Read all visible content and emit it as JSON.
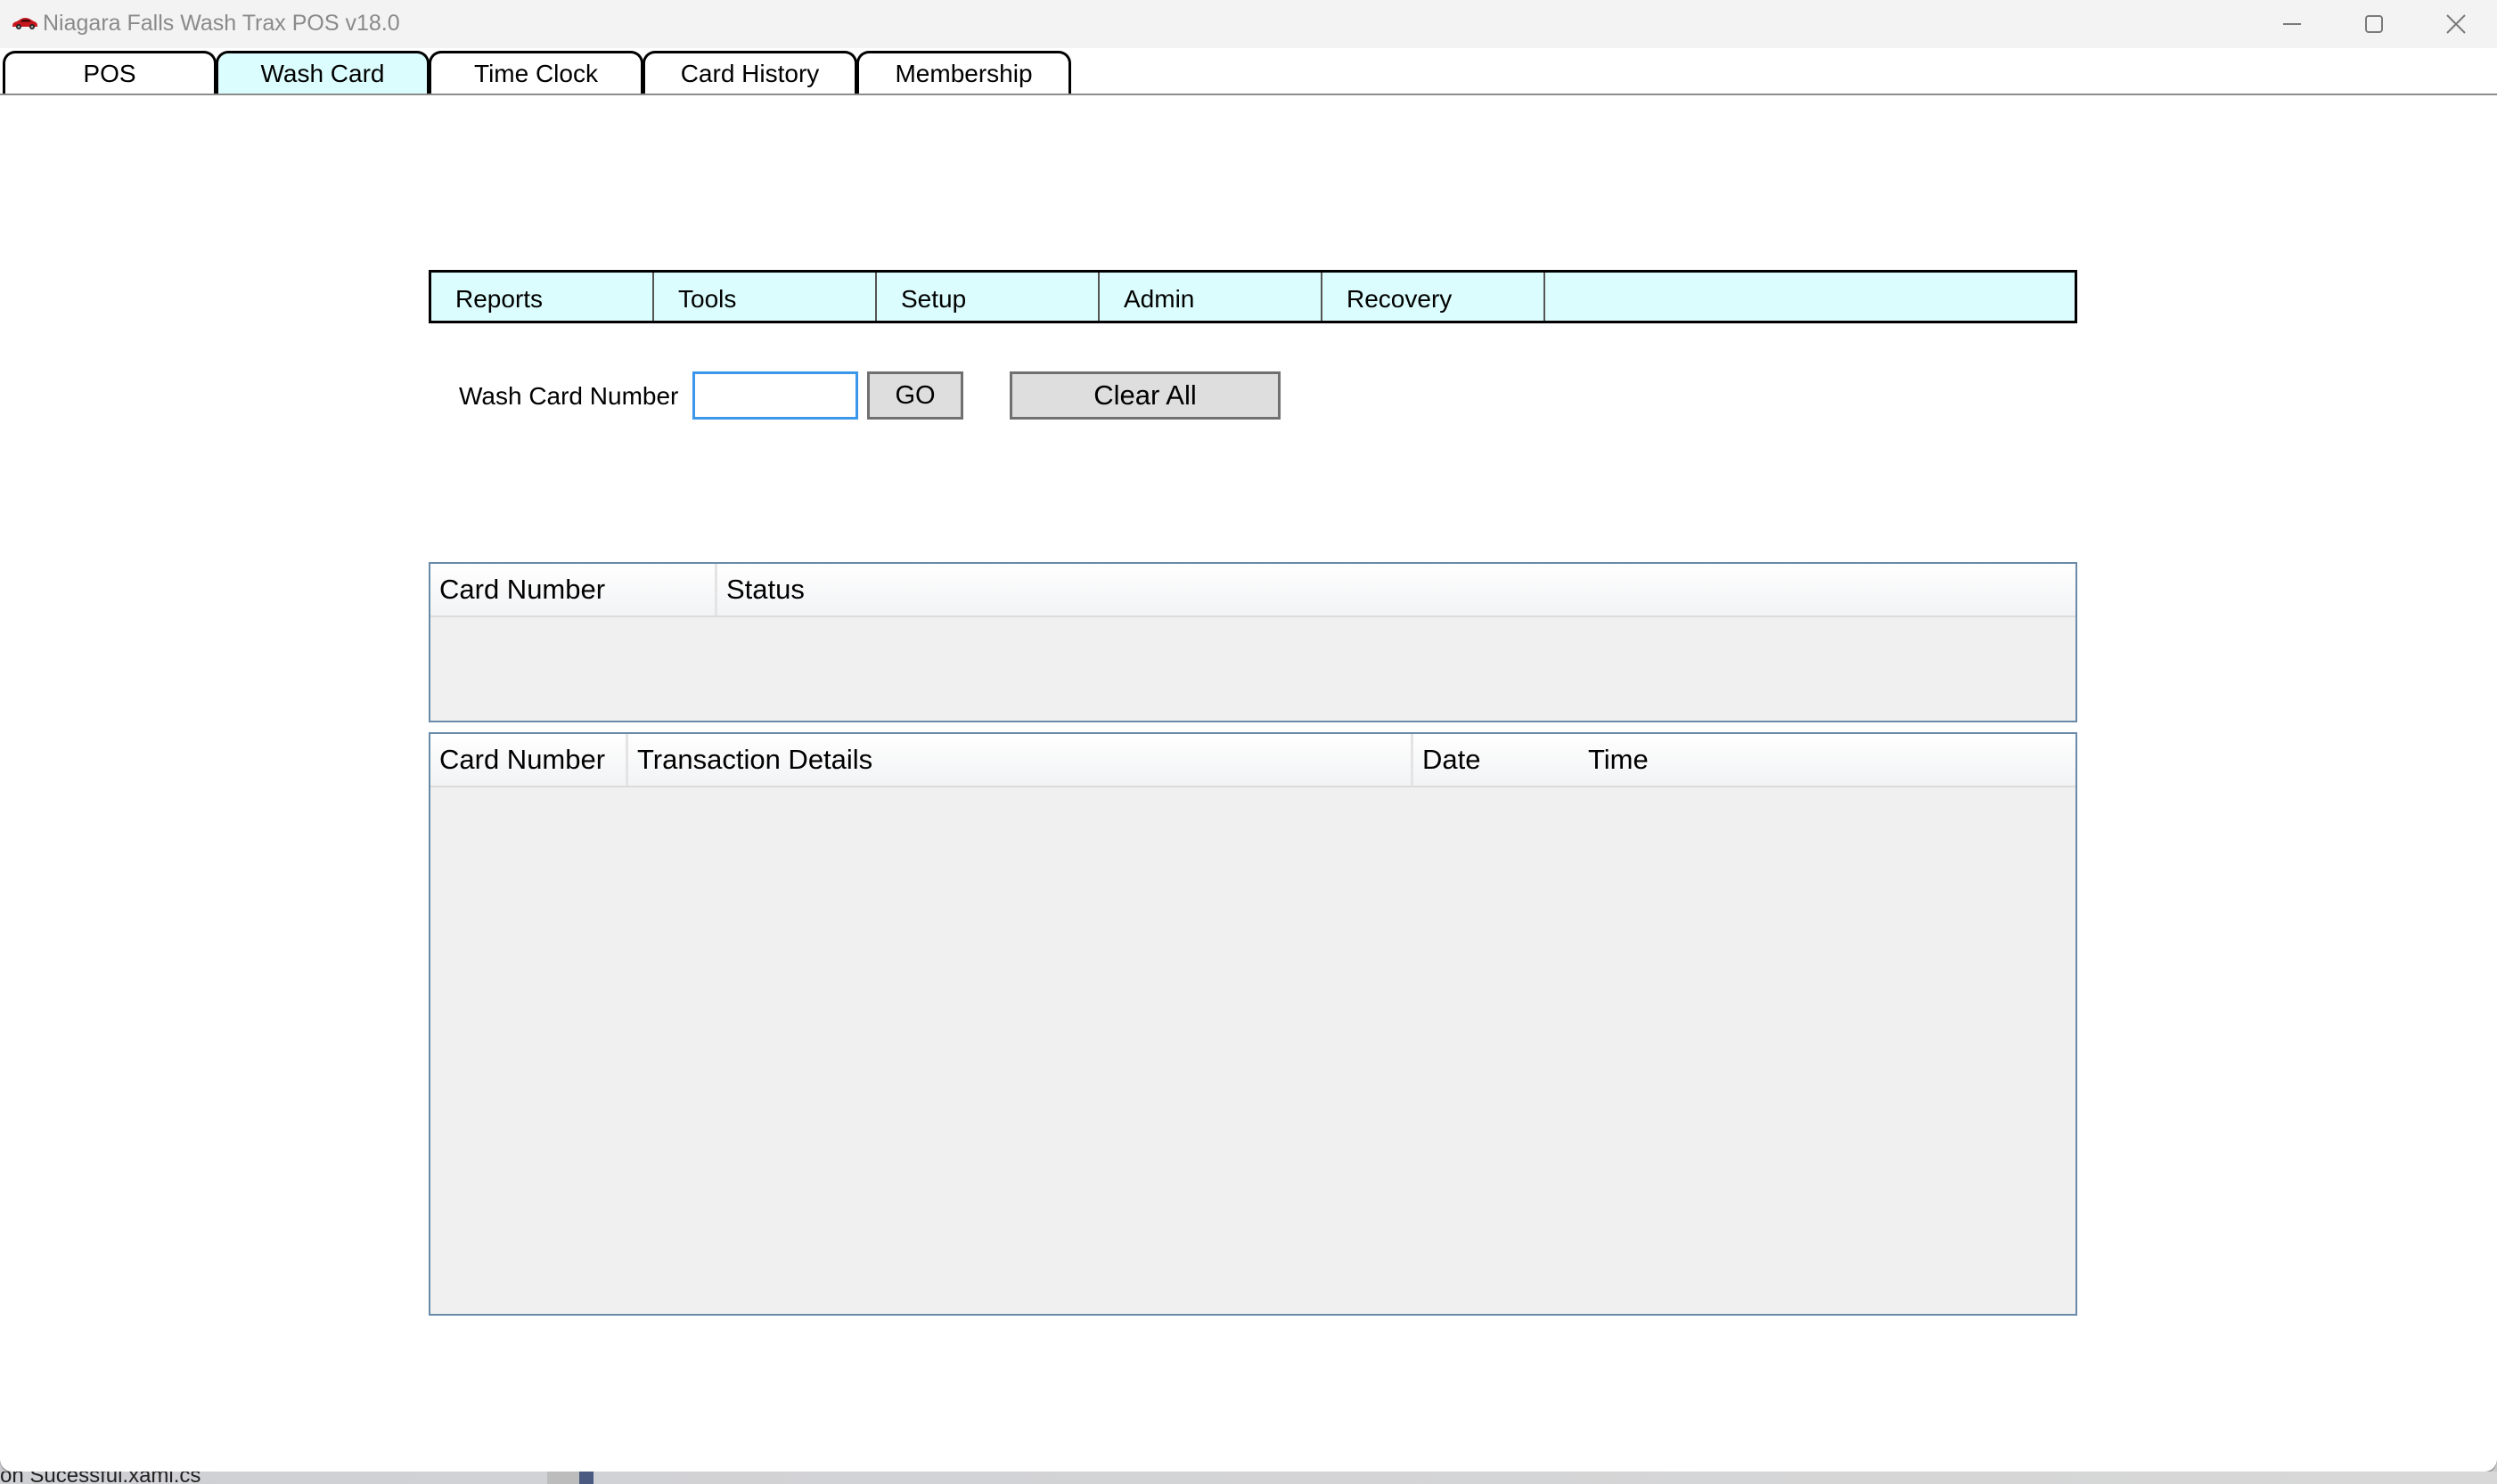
{
  "window": {
    "title": "Niagara Falls Wash Trax POS v18.0",
    "app_icon": "red-car-icon",
    "controls": [
      "minimize",
      "maximize",
      "close"
    ]
  },
  "tabs": [
    {
      "label": "POS",
      "active": false
    },
    {
      "label": "Wash Card",
      "active": true
    },
    {
      "label": "Time Clock",
      "active": false
    },
    {
      "label": "Card History",
      "active": false
    },
    {
      "label": "Membership",
      "active": false
    }
  ],
  "menu": {
    "items": [
      "Reports",
      "Tools",
      "Setup",
      "Admin",
      "Recovery"
    ]
  },
  "wash_card": {
    "label": "Wash Card Number",
    "input_value": "",
    "go_label": "GO",
    "clear_label": "Clear All"
  },
  "status_grid": {
    "columns": [
      "Card Number",
      "Status"
    ],
    "rows": []
  },
  "transactions_grid": {
    "columns": [
      "Card Number",
      "Transaction Details",
      "Date",
      "Time"
    ],
    "rows": []
  },
  "taskbar": {
    "partial_text": "on Sucessful.xaml.cs"
  },
  "colors": {
    "active_tab": "#dcfdfd",
    "menu_bar": "#dcfdfd",
    "input_focus_border": "#3c96ea",
    "grid_border": "#6a8aa9",
    "grid_background": "#f0f0f0",
    "button_background": "#dedede"
  }
}
